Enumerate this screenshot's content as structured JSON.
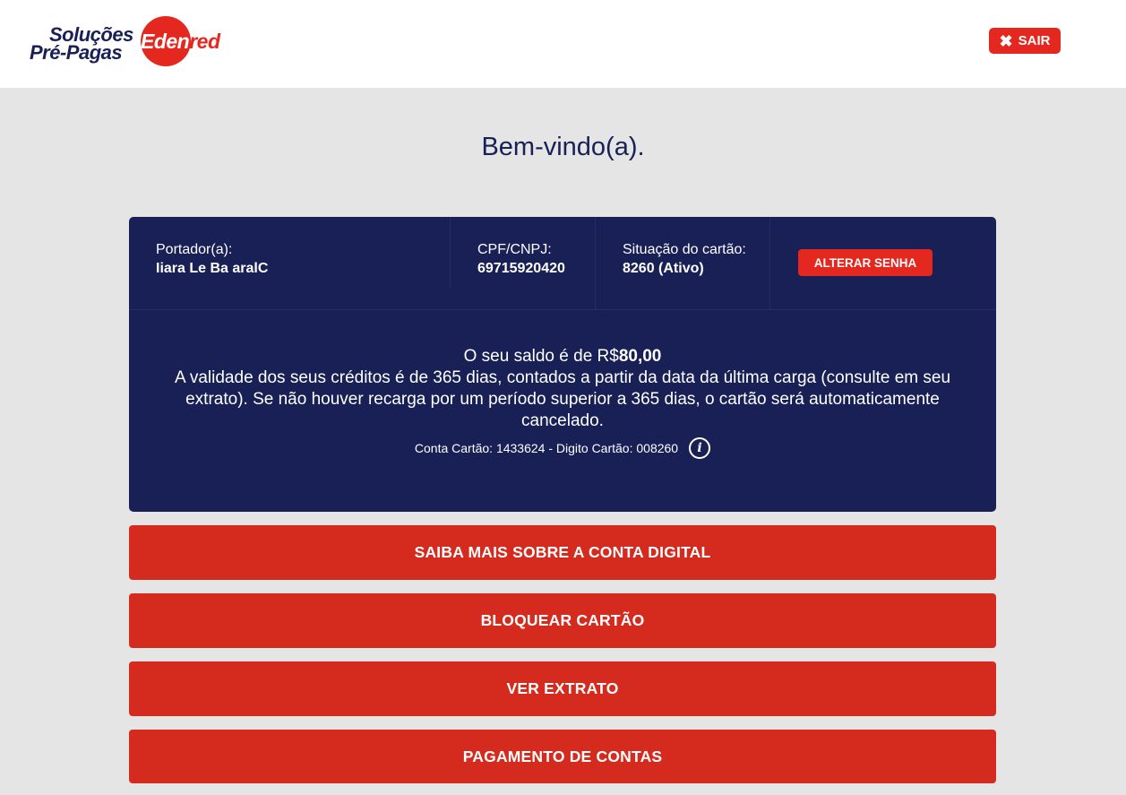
{
  "logo": {
    "line1": "Soluções",
    "line2": "Pré-Pagas",
    "brand_head": "Eden",
    "brand_tail": "red"
  },
  "header": {
    "logout_label": "SAIR"
  },
  "welcome": "Bem-vindo(a).",
  "card": {
    "holder_label": "Portador(a):",
    "holder_value": "Iiara Le Ba aralC",
    "doc_label": "CPF/CNPJ:",
    "doc_value": "69715920420",
    "status_label": "Situação do cartão:",
    "status_value": "8260 (Ativo)",
    "change_password_label": "ALTERAR SENHA",
    "balance_prefix": "O seu saldo é de R$",
    "balance_amount": "80,00",
    "validity_text": "A validade dos seus créditos é de 365 dias, contados a partir da data da última carga (consulte em seu extrato). Se não houver recarga por um período superior a 365 dias, o cartão será automaticamente cancelado.",
    "account_text": "Conta Cartão: 1433624 - Digito Cartão: 008260",
    "info_glyph": "i"
  },
  "actions": [
    {
      "label": "SAIBA MAIS SOBRE A CONTA DIGITAL"
    },
    {
      "label": "BLOQUEAR CARTÃO"
    },
    {
      "label": "VER EXTRATO"
    },
    {
      "label": "PAGAMENTO DE CONTAS"
    }
  ],
  "colors": {
    "navy": "#182055",
    "red": "#d52b1e",
    "background": "#e5e5e5"
  }
}
